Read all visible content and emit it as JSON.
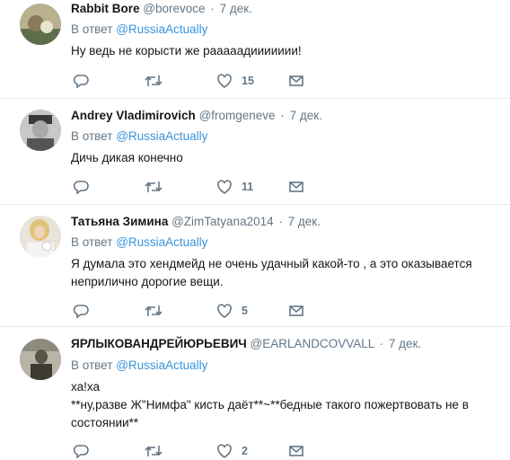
{
  "tweets": [
    {
      "name": "Rabbit Bore",
      "handle": "@borevoce",
      "separator": "·",
      "date": "7 дек.",
      "reply_prefix": "В ответ",
      "reply_to": "@RussiaActually",
      "text_lines": [
        "Ну ведь не корысти же рааааадиииииии!"
      ],
      "likes": "15",
      "avatar_color": "#7a8a6a"
    },
    {
      "name": "Andrey Vladimirovich",
      "handle": "@fromgeneve",
      "separator": "·",
      "date": "7 дек.",
      "reply_prefix": "В ответ",
      "reply_to": "@RussiaActually",
      "text_lines": [
        "Дичь дикая конечно"
      ],
      "likes": "11",
      "avatar_color": "#9a9a9a"
    },
    {
      "name": "Татьяна Зимина",
      "handle": "@ZimTatyana2014",
      "separator": "·",
      "date": "7 дек.",
      "reply_prefix": "В ответ",
      "reply_to": "@RussiaActually",
      "text_lines": [
        "Я думала это хендмейд  не очень удачный какой-то , а это оказывается",
        "неприлично дорогие вещи."
      ],
      "likes": "5",
      "avatar_color": "#d9c9a8"
    },
    {
      "name": "ЯРЛЫКОВАНДРЕЙЮРЬЕВИЧ",
      "handle": "@EARLANDCOVVALL",
      "separator": "·",
      "date": "7 дек.",
      "reply_prefix": "В ответ",
      "reply_to": "@RussiaActually",
      "text_lines": [
        "ха!ха",
        "**ну,разве Ж\"Нимфа\" кисть даёт**~**бедные такого пожертвовать не в",
        "состоянии**"
      ],
      "likes": "2",
      "avatar_color": "#6d6a5e"
    }
  ],
  "colors": {
    "link": "#3b94d9",
    "muted": "#657786",
    "text": "#14171a",
    "divider": "#e6ecf0"
  },
  "icons": [
    "reply-icon",
    "retweet-icon",
    "like-icon",
    "direct-message-icon"
  ]
}
